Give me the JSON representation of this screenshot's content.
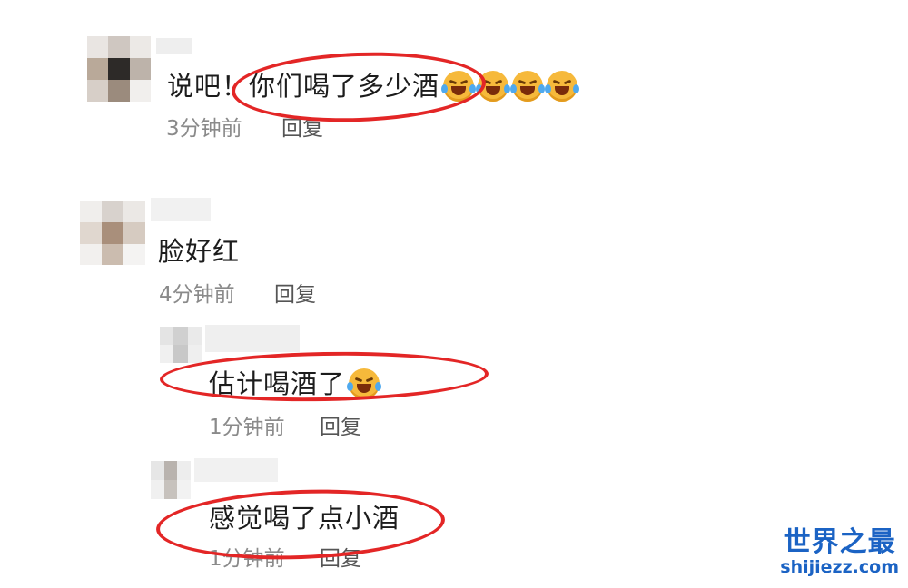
{
  "comments": [
    {
      "text": "说吧！你们喝了多少酒",
      "emoji_count": 4,
      "emoji_icon": "rolling-laughing-face",
      "time": "3分钟前",
      "reply_label": "回复"
    },
    {
      "text": "脸好红",
      "time": "4分钟前",
      "reply_label": "回复",
      "replies": [
        {
          "text": "估计喝酒了",
          "emoji_count": 1,
          "emoji_icon": "rolling-laughing-face",
          "time": "1分钟前",
          "reply_label": "回复"
        },
        {
          "text": "感觉喝了点小酒",
          "time": "1分钟前",
          "reply_label": "回复"
        }
      ]
    }
  ],
  "watermark": {
    "title": "世界之最",
    "url": "shijiezz.com"
  },
  "colors": {
    "highlight_oval": "#e32626",
    "watermark": "#1b63c4",
    "meta_text": "#8a8a8a"
  }
}
